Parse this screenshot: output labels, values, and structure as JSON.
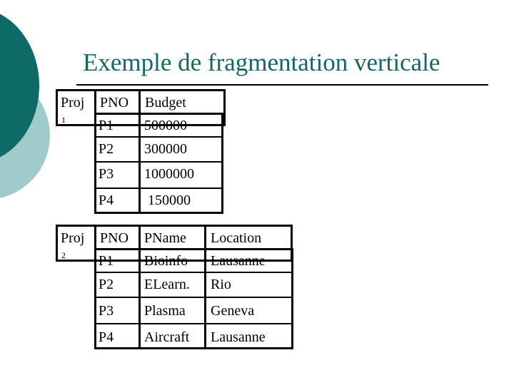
{
  "slide": {
    "title": "Exemple de fragmentation verticale",
    "accent_color": "#156663",
    "decor_dark": "#0e6a66",
    "decor_light": "#9fcbcb"
  },
  "fragments": [
    {
      "name": "Proj",
      "subscript": "1",
      "columns": [
        "PNO",
        "Budget"
      ],
      "rows": [
        [
          "P1",
          "500000"
        ],
        [
          "P2",
          "300000"
        ],
        [
          "P3",
          "1000000"
        ],
        [
          "P4",
          " 150000"
        ]
      ]
    },
    {
      "name": "Proj",
      "subscript": "2",
      "columns": [
        "PNO",
        "PName",
        "Location"
      ],
      "rows": [
        [
          "P1",
          "Bioinfo",
          "Lausanne"
        ],
        [
          "P2",
          "ELearn.",
          "Rio"
        ],
        [
          "P3",
          "Plasma",
          "Geneva"
        ],
        [
          "P4",
          "Aircraft",
          "Lausanne"
        ]
      ]
    }
  ]
}
